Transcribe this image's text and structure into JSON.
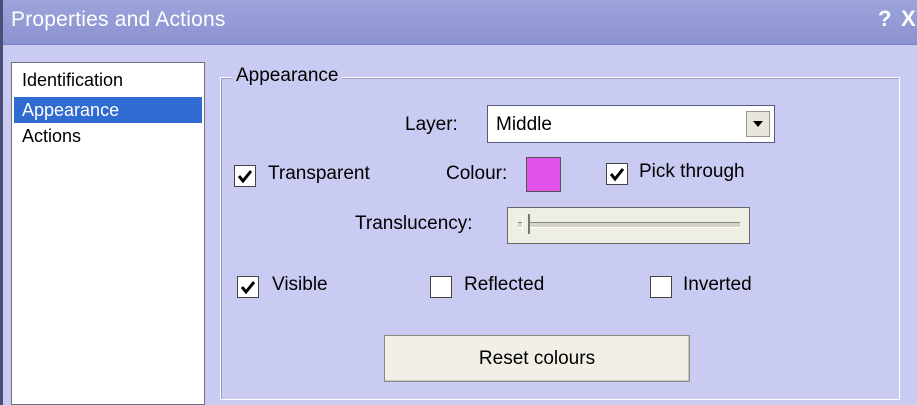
{
  "window": {
    "title": "Properties and Actions",
    "help_icon": "?",
    "close_icon": "X"
  },
  "nav": {
    "items": [
      {
        "label": "Identification",
        "selected": false
      },
      {
        "label": "Appearance",
        "selected": true
      },
      {
        "label": "Actions",
        "selected": false
      }
    ]
  },
  "appearance": {
    "group_title": "Appearance",
    "layer_label": "Layer:",
    "layer_value": "Middle",
    "transparent_label": "Transparent",
    "transparent_checked": true,
    "colour_label": "Colour:",
    "colour_value": "#e052e8",
    "pick_through_label": "Pick through",
    "pick_through_checked": true,
    "translucency_label": "Translucency:",
    "translucency_level": 0.02,
    "visible_label": "Visible",
    "visible_checked": true,
    "reflected_label": "Reflected",
    "reflected_checked": false,
    "inverted_label": "Inverted",
    "inverted_checked": false,
    "reset_button_label": "Reset colours"
  },
  "colors": {
    "window_bg": "#c9cbf2",
    "titlebar": "#8b92cf",
    "selection": "#2f6bd0"
  }
}
